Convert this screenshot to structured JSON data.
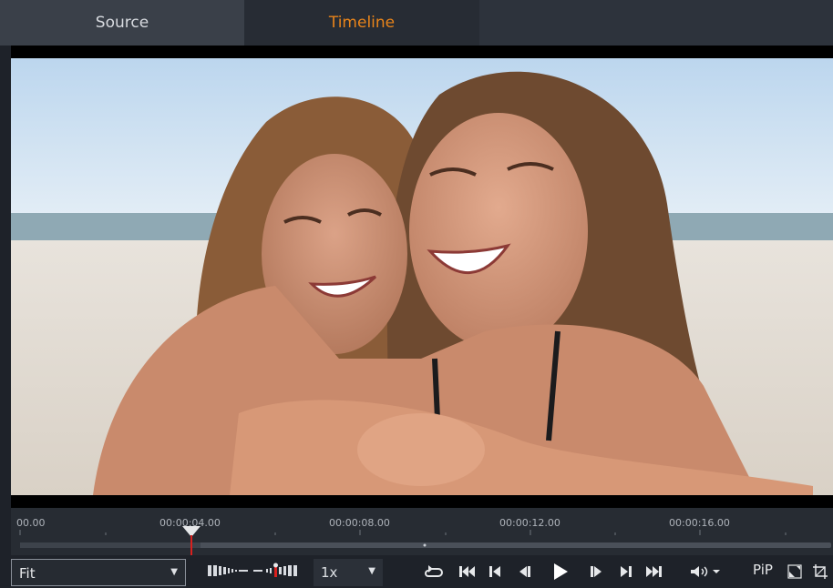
{
  "tabs": {
    "source_label": "Source",
    "timeline_label": "Timeline"
  },
  "ruler": {
    "labels": [
      "00.00",
      "00:00:04.00",
      "00:00:08.00",
      "00:00:12.00",
      "00:00:16.00"
    ],
    "playhead_time": "00:00:04.00"
  },
  "controls": {
    "zoom_value": "Fit",
    "speed_value": "1x",
    "pip_label": "PiP"
  },
  "colors": {
    "accent": "#e8841a",
    "playhead": "#d9201e"
  },
  "icons": [
    "loop-icon",
    "go-to-start-icon",
    "previous-frame-icon",
    "step-back-icon",
    "play-icon",
    "step-forward-icon",
    "next-frame-icon",
    "go-to-end-icon",
    "volume-icon",
    "fullscreen-icon",
    "crop-icon"
  ]
}
